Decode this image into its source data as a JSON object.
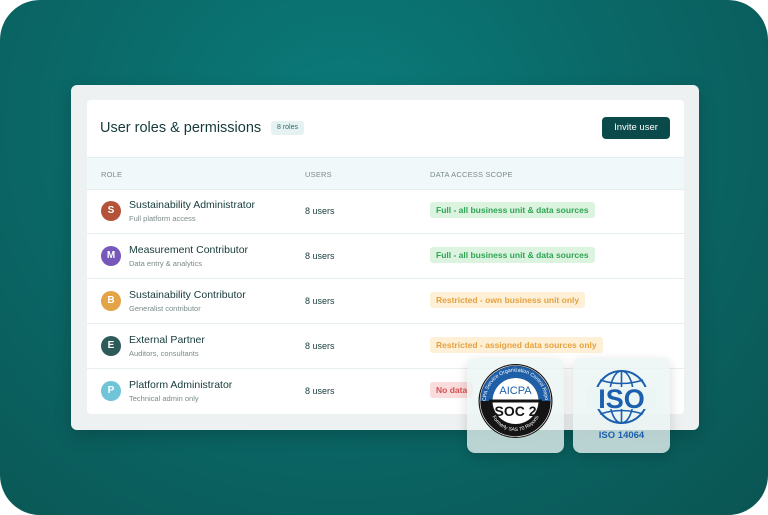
{
  "header": {
    "title": "User roles & permissions",
    "badge": "8 roles",
    "invite_label": "Invite user"
  },
  "columns": {
    "role": "ROLE",
    "users": "USERS",
    "scope": "DATA ACCESS SCOPE"
  },
  "rows": [
    {
      "initial": "S",
      "name": "Sustainability Administrator",
      "desc": "Full platform access",
      "users": "8 users",
      "scope": "Full - all business unit & data sources",
      "scope_type": "full",
      "color": "#b5533a"
    },
    {
      "initial": "M",
      "name": "Measurement Contributor",
      "desc": "Data entry & analytics",
      "users": "8 users",
      "scope": "Full - all business unit & data sources",
      "scope_type": "full",
      "color": "#7558b8"
    },
    {
      "initial": "B",
      "name": "Sustainability Contributor",
      "desc": "Generalist contributor",
      "users": "8 users",
      "scope": "Restricted - own business unit only",
      "scope_type": "restricted",
      "color": "#e2a447"
    },
    {
      "initial": "E",
      "name": "External Partner",
      "desc": "Auditors, consultants",
      "users": "8 users",
      "scope": "Restricted - assigned data sources only",
      "scope_type": "restricted",
      "color": "#2f5a5a"
    },
    {
      "initial": "P",
      "name": "Platform Administrator",
      "desc": "Technical admin only",
      "users": "8 users",
      "scope": "No data",
      "scope_type": "none",
      "color": "#6fc4d7"
    }
  ],
  "certs": {
    "soc": {
      "org": "AICPA",
      "name": "SOC 2",
      "ring_top": "AICPA Service Organization Control Reports",
      "ring_bottom": "Formerly SAS 70 Reports"
    },
    "iso": {
      "name": "ISO",
      "standard": "ISO 14064"
    }
  }
}
